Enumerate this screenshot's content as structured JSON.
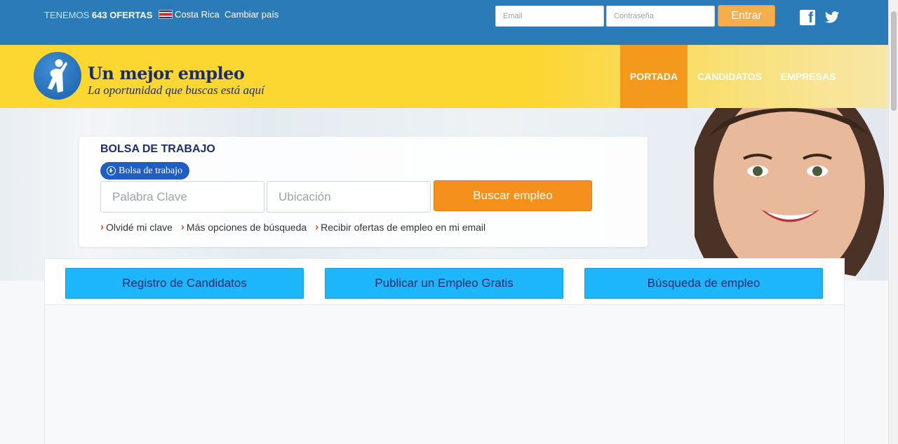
{
  "topbar": {
    "offers_prefix": "TENEMOS",
    "offers_count": "643 OFERTAS",
    "country": "Costa Rica",
    "change_country": "Cambiar país",
    "email_placeholder": "Email",
    "password_placeholder": "Contraseña",
    "login_label": "Entrar"
  },
  "header": {
    "logo_title": "Un mejor empleo",
    "logo_tagline": "La oportunidad que buscas está aquí",
    "nav": [
      {
        "label": "PORTADA",
        "active": true
      },
      {
        "label": "CANDIDATOS",
        "active": false
      },
      {
        "label": "EMPRESAS",
        "active": false
      }
    ]
  },
  "search": {
    "title": "BOLSA DE TRABAJO",
    "pill_label": "Bolsa de trabajo",
    "keyword_placeholder": "Palabra Clave",
    "location_placeholder": "Ubicación",
    "button_label": "Buscar empleo",
    "links": [
      "Olvidé mi clave",
      "Más opciones de búsqueda",
      "Recibir ofertas de empleo en mi email"
    ]
  },
  "actions": [
    "Registro de Candidatos",
    "Publicar un Empleo Gratis",
    "Búsqueda de empleo"
  ],
  "colors": {
    "topbar": "#2b7bb9",
    "header_yellow": "#fcd631",
    "nav_active": "#f39a1c",
    "search_button": "#f6901d",
    "action_button": "#1eb6fb",
    "brand_navy": "#1c2d6b"
  },
  "icons": [
    "facebook-icon",
    "twitter-icon",
    "plus-circle-icon",
    "chevron-right-icon"
  ]
}
